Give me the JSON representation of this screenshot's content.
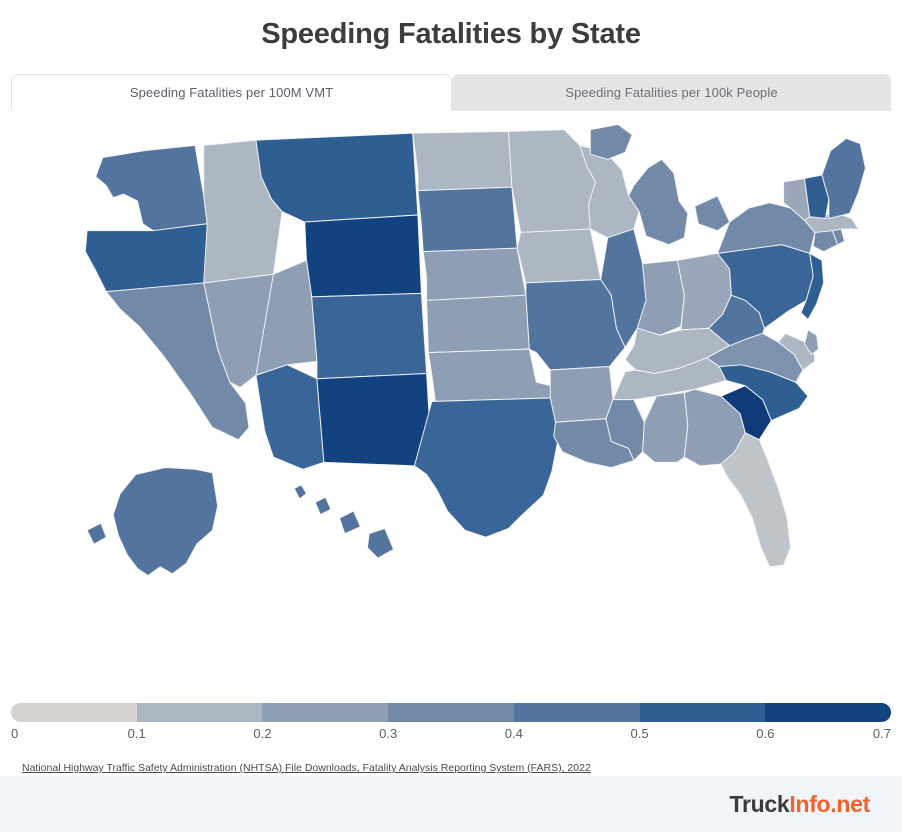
{
  "header": {
    "title": "Speeding Fatalities by State"
  },
  "tabs": [
    {
      "label": "Speeding Fatalities per 100M VMT",
      "active": true
    },
    {
      "label": "Speeding Fatalities per 100k People",
      "active": false
    }
  ],
  "legend": {
    "ticks": [
      "0",
      "0.1",
      "0.2",
      "0.3",
      "0.4",
      "0.5",
      "0.6",
      "0.7"
    ],
    "colors": [
      "#d6d3d1",
      "#adb7c4",
      "#8e9fb5",
      "#7389a8",
      "#53749e",
      "#2f5e92",
      "#12427f"
    ]
  },
  "source": {
    "text": "National Highway Traffic Safety Administration (NHTSA) File Downloads, Fatality Analysis Reporting System (FARS), 2022"
  },
  "footer": {
    "logo_part1": "Truck",
    "logo_part2": "Info.net"
  },
  "chart_data": {
    "type": "choropleth",
    "title": "Speeding Fatalities by State",
    "metric": "Speeding Fatalities per 100M VMT",
    "unit": "per 100M VMT",
    "source": "National Highway Traffic Safety Administration (NHTSA) File Downloads, Fatality Analysis Reporting System (FARS), 2022",
    "colorscale": [
      "#d6d3d1",
      "#adb7c4",
      "#8e9fb5",
      "#7389a8",
      "#53749e",
      "#2f5e92",
      "#12427f"
    ],
    "zmin": 0,
    "zmax": 0.7,
    "colorbar_ticks": [
      0,
      0.1,
      0.2,
      0.3,
      0.4,
      0.5,
      0.6,
      0.7
    ],
    "states": [
      {
        "code": "AL",
        "name": "Alabama",
        "value": 0.21,
        "color": "#8e9fb5"
      },
      {
        "code": "AK",
        "name": "Alaska",
        "value": 0.38,
        "color": "#53749e"
      },
      {
        "code": "AZ",
        "name": "Arizona",
        "value": 0.41,
        "color": "#3a6598"
      },
      {
        "code": "AR",
        "name": "Arkansas",
        "value": 0.23,
        "color": "#8e9fb5"
      },
      {
        "code": "CA",
        "name": "California",
        "value": 0.3,
        "color": "#7389a8"
      },
      {
        "code": "CO",
        "name": "Colorado",
        "value": 0.44,
        "color": "#3a6598"
      },
      {
        "code": "CT",
        "name": "Connecticut",
        "value": 0.34,
        "color": "#7389a8"
      },
      {
        "code": "DE",
        "name": "Delaware",
        "value": 0.2,
        "color": "#8e9fb5"
      },
      {
        "code": "DC",
        "name": "District of Columbia",
        "value": 0.46,
        "color": "#2f5e92"
      },
      {
        "code": "FL",
        "name": "Florida",
        "value": 0.13,
        "color": "#bfc4c8"
      },
      {
        "code": "GA",
        "name": "Georgia",
        "value": 0.27,
        "color": "#8e9fb5"
      },
      {
        "code": "HI",
        "name": "Hawaii",
        "value": 0.38,
        "color": "#53749e"
      },
      {
        "code": "ID",
        "name": "Idaho",
        "value": 0.18,
        "color": "#adb7c4"
      },
      {
        "code": "IL",
        "name": "Illinois",
        "value": 0.37,
        "color": "#53749e"
      },
      {
        "code": "IN",
        "name": "Indiana",
        "value": 0.21,
        "color": "#8e9fb5"
      },
      {
        "code": "IA",
        "name": "Iowa",
        "value": 0.16,
        "color": "#adb7c4"
      },
      {
        "code": "KS",
        "name": "Kansas",
        "value": 0.25,
        "color": "#8e9fb5"
      },
      {
        "code": "KY",
        "name": "Kentucky",
        "value": 0.16,
        "color": "#adb7c4"
      },
      {
        "code": "LA",
        "name": "Louisiana",
        "value": 0.31,
        "color": "#7389a8"
      },
      {
        "code": "ME",
        "name": "Maine",
        "value": 0.35,
        "color": "#53749e"
      },
      {
        "code": "MD",
        "name": "Maryland",
        "value": 0.19,
        "color": "#adb7c4"
      },
      {
        "code": "MA",
        "name": "Massachusetts",
        "value": 0.17,
        "color": "#adb7c4"
      },
      {
        "code": "MI",
        "name": "Michigan",
        "value": 0.33,
        "color": "#7389a8"
      },
      {
        "code": "MN",
        "name": "Minnesota",
        "value": 0.18,
        "color": "#adb7c4"
      },
      {
        "code": "MS",
        "name": "Mississippi",
        "value": 0.3,
        "color": "#7389a8"
      },
      {
        "code": "MO",
        "name": "Missouri",
        "value": 0.37,
        "color": "#53749e"
      },
      {
        "code": "MT",
        "name": "Montana",
        "value": 0.5,
        "color": "#2f5e92"
      },
      {
        "code": "NE",
        "name": "Nebraska",
        "value": 0.22,
        "color": "#8e9fb5"
      },
      {
        "code": "NV",
        "name": "Nevada",
        "value": 0.24,
        "color": "#8e9fb5"
      },
      {
        "code": "NH",
        "name": "New Hampshire",
        "value": 0.52,
        "color": "#2f5e92"
      },
      {
        "code": "NJ",
        "name": "New Jersey",
        "value": 0.46,
        "color": "#2f5e92"
      },
      {
        "code": "NM",
        "name": "New Mexico",
        "value": 0.62,
        "color": "#12427f"
      },
      {
        "code": "NY",
        "name": "New York",
        "value": 0.32,
        "color": "#7389a8"
      },
      {
        "code": "NC",
        "name": "North Carolina",
        "value": 0.45,
        "color": "#2f5e92"
      },
      {
        "code": "ND",
        "name": "North Dakota",
        "value": 0.19,
        "color": "#adb7c4"
      },
      {
        "code": "OH",
        "name": "Ohio",
        "value": 0.2,
        "color": "#9aa7b8"
      },
      {
        "code": "OK",
        "name": "Oklahoma",
        "value": 0.25,
        "color": "#8e9fb5"
      },
      {
        "code": "OR",
        "name": "Oregon",
        "value": 0.45,
        "color": "#2f5e92"
      },
      {
        "code": "PA",
        "name": "Pennsylvania",
        "value": 0.44,
        "color": "#3a6598"
      },
      {
        "code": "RI",
        "name": "Rhode Island",
        "value": 0.3,
        "color": "#7389a8"
      },
      {
        "code": "SC",
        "name": "South Carolina",
        "value": 0.68,
        "color": "#0f3c78"
      },
      {
        "code": "SD",
        "name": "South Dakota",
        "value": 0.4,
        "color": "#53749e"
      },
      {
        "code": "TN",
        "name": "Tennessee",
        "value": 0.15,
        "color": "#adb7c4"
      },
      {
        "code": "TX",
        "name": "Texas",
        "value": 0.42,
        "color": "#3a6598"
      },
      {
        "code": "UT",
        "name": "Utah",
        "value": 0.22,
        "color": "#8e9fb5"
      },
      {
        "code": "VT",
        "name": "Vermont",
        "value": 0.21,
        "color": "#9aa7b8"
      },
      {
        "code": "VA",
        "name": "Virginia",
        "value": 0.28,
        "color": "#7e92ad"
      },
      {
        "code": "WA",
        "name": "Washington",
        "value": 0.36,
        "color": "#53749e"
      },
      {
        "code": "WV",
        "name": "West Virginia",
        "value": 0.39,
        "color": "#53749e"
      },
      {
        "code": "WI",
        "name": "Wisconsin",
        "value": 0.19,
        "color": "#adb7c4"
      },
      {
        "code": "WY",
        "name": "Wyoming",
        "value": 0.64,
        "color": "#12427f"
      }
    ]
  }
}
